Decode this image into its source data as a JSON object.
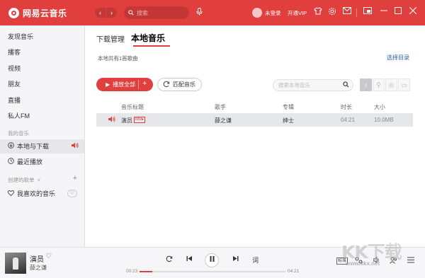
{
  "app": {
    "title": "网易云音乐",
    "accent_color": "#e13e3e"
  },
  "titlebar": {
    "back_icon": "chevron-left-icon",
    "forward_icon": "chevron-right-icon",
    "search_placeholder": "搜索",
    "mic_icon": "microphone-icon",
    "login_label": "未登录",
    "vip_label": "开通VIP",
    "icons": [
      "shirt-icon",
      "gear-icon",
      "mail-icon",
      "miniplayer-icon",
      "minimize-icon",
      "maximize-icon",
      "close-icon"
    ]
  },
  "sidebar": {
    "items_top": [
      {
        "label": "发现音乐"
      },
      {
        "label": "播客"
      },
      {
        "label": "视频"
      },
      {
        "label": "朋友"
      },
      {
        "label": "直播"
      },
      {
        "label": "私人FM"
      }
    ],
    "my_music_header": "我的音乐",
    "my_music": [
      {
        "label": "本地与下载",
        "icon": "download-icon",
        "active": true
      },
      {
        "label": "最近播放",
        "icon": "clock-icon"
      }
    ],
    "created_header": "创建的歌单",
    "created": [
      {
        "label": "我喜欢的音乐",
        "icon": "heart-icon"
      }
    ]
  },
  "main": {
    "tabs": [
      {
        "label": "下载管理"
      },
      {
        "label": "本地音乐",
        "active": true
      }
    ],
    "summary": "本地共有1首歌曲",
    "choose_dir": "选择目录",
    "play_all_label": "播放全部",
    "match_label": "匹配音乐",
    "search_placeholder": "搜索本地音乐",
    "view_icons": [
      "music-note-icon",
      "person-icon",
      "disc-icon",
      "folder-icon"
    ],
    "columns": [
      "音乐标题",
      "歌手",
      "专辑",
      "时长",
      "大小"
    ],
    "rows": [
      {
        "title": "演员",
        "tag": "MV▸",
        "artist": "薛之谦",
        "album": "绅士",
        "duration": "04:21",
        "size": "10.0MB",
        "playing": true
      }
    ]
  },
  "player": {
    "song": "演员",
    "artist": "薛之谦",
    "elapsed": "00:23",
    "total": "04:21",
    "progress": 0.088,
    "lyric_label": "词",
    "quality_label": "标准"
  },
  "watermark": {
    "text": "KK下载",
    "url": "www.kkx.net"
  }
}
